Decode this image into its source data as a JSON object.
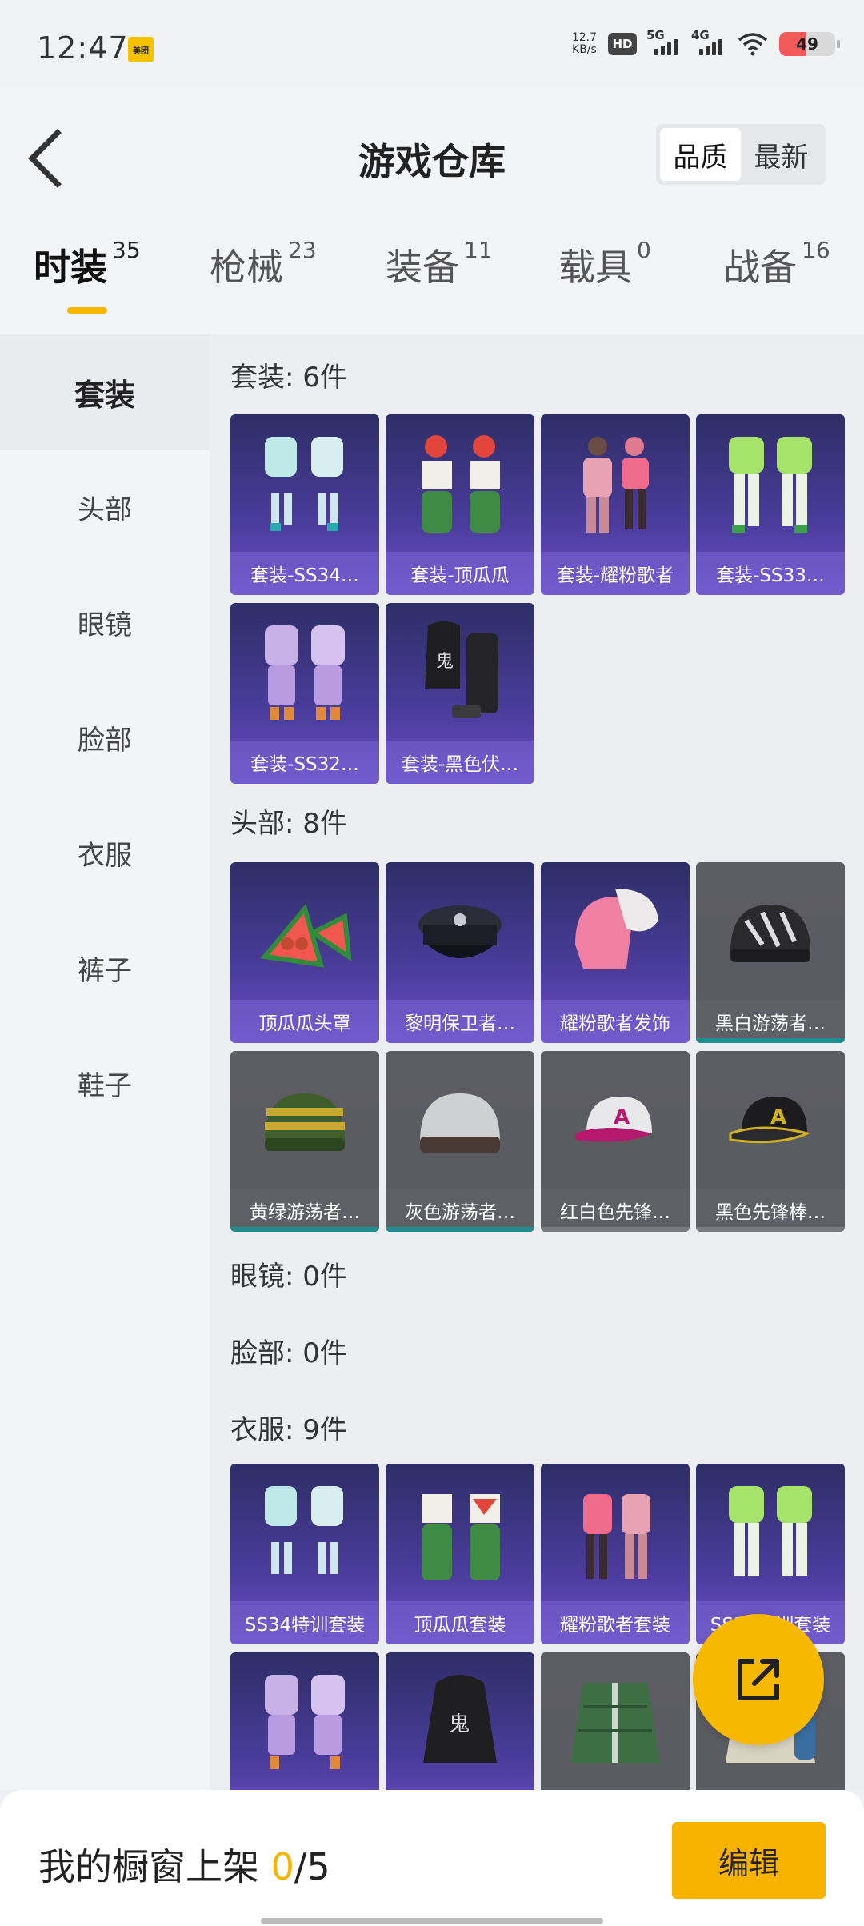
{
  "status": {
    "time": "12:47",
    "app_badge": "美团",
    "net_speed_value": "12.7",
    "net_speed_unit": "KB/s",
    "hd": "HD",
    "sig1": "5G",
    "sig2": "4G",
    "battery": "49"
  },
  "header": {
    "title": "游戏仓库",
    "sort": [
      "品质",
      "最新"
    ]
  },
  "tabs": [
    {
      "label": "时装",
      "count": "35"
    },
    {
      "label": "枪械",
      "count": "23"
    },
    {
      "label": "装备",
      "count": "11"
    },
    {
      "label": "载具",
      "count": "0"
    },
    {
      "label": "战备",
      "count": "16"
    }
  ],
  "sidebar": [
    "套装",
    "头部",
    "眼镜",
    "脸部",
    "衣服",
    "裤子",
    "鞋子"
  ],
  "sections": {
    "suits_title": "套装: 6件",
    "head_title": "头部: 8件",
    "glasses_title": "眼镜: 0件",
    "face_title": "脸部: 0件",
    "clothes_title": "衣服: 9件"
  },
  "suits": [
    "套装-SS34…",
    "套装-顶瓜瓜",
    "套装-耀粉歌者",
    "套装-SS33…",
    "套装-SS32…",
    "套装-黑色伏…"
  ],
  "heads": [
    "顶瓜瓜头罩",
    "黎明保卫者…",
    "耀粉歌者发饰",
    "黑白游荡者…",
    "黄绿游荡者…",
    "灰色游荡者…",
    "红白色先锋…",
    "黑色先锋棒…"
  ],
  "clothes": [
    "SS34特训套装",
    "顶瓜瓜套装",
    "耀粉歌者套装",
    "SS33特训套装"
  ],
  "bottom": {
    "label": "我的橱窗上架",
    "current": "0",
    "total": "/5",
    "edit": "编辑"
  }
}
